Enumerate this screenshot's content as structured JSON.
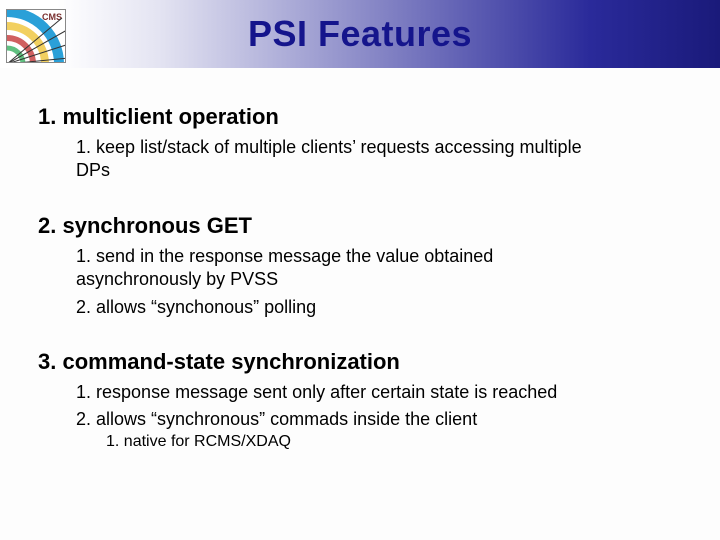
{
  "header": {
    "logo_label": "CMS",
    "title": "PSI Features"
  },
  "sections": [
    {
      "num": "1.",
      "title": "multiclient operation",
      "items": [
        {
          "num": "1.",
          "text": "keep list/stack of multiple clients’ requests accessing multiple DPs"
        }
      ]
    },
    {
      "num": "2.",
      "title": "synchronous GET",
      "items": [
        {
          "num": "1.",
          "text": "send in the response message the value obtained asynchronously by PVSS"
        },
        {
          "num": "2.",
          "text": "allows “synchonous” polling"
        }
      ]
    },
    {
      "num": "3.",
      "title": "command-state synchronization",
      "items": [
        {
          "num": "1.",
          "text": "response message sent only after certain state is reached"
        },
        {
          "num": "2.",
          "text": "allows “synchronous” commads inside the client",
          "sub": [
            {
              "num": "1.",
              "text": "native for RCMS/XDAQ"
            }
          ]
        }
      ]
    }
  ]
}
